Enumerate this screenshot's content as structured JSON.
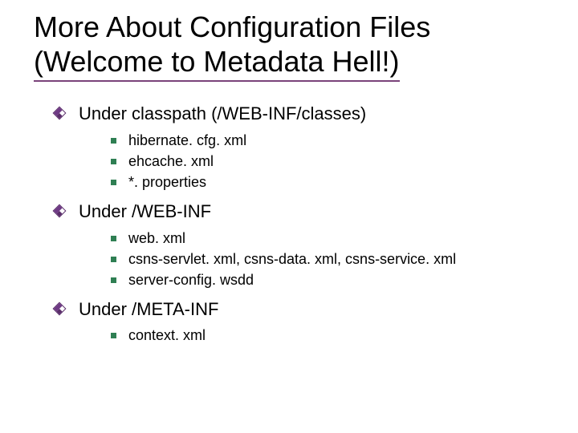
{
  "title": {
    "line1": "More About Configuration Files",
    "line2": "(Welcome to Metadata Hell!)"
  },
  "bullets": [
    {
      "label": "Under classpath (/WEB-INF/classes)",
      "items": [
        "hibernate. cfg. xml",
        "ehcache. xml",
        "*. properties"
      ]
    },
    {
      "label": "Under /WEB-INF",
      "items": [
        "web. xml",
        "csns-servlet. xml, csns-data. xml, csns-service. xml",
        "server-config. wsdd"
      ]
    },
    {
      "label": "Under /META-INF",
      "items": [
        "context. xml"
      ]
    }
  ]
}
